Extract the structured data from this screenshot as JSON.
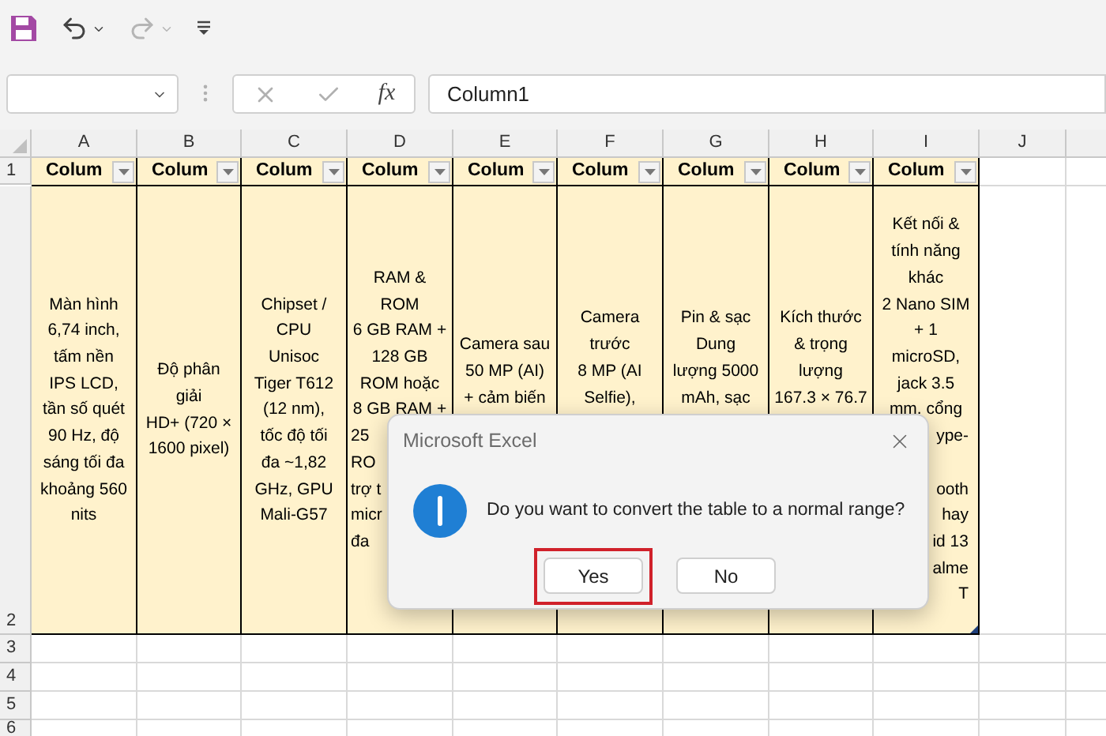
{
  "quick_access": [
    {
      "kind": "save",
      "disabled": false
    },
    {
      "kind": "undo",
      "disabled": false
    },
    {
      "kind": "redo",
      "disabled": true
    },
    {
      "kind": "customize",
      "disabled": false
    }
  ],
  "formula_bar": {
    "function_label": "fx",
    "value": "Column1"
  },
  "columns": [
    "A",
    "B",
    "C",
    "D",
    "E",
    "F",
    "G",
    "H",
    "I",
    "J"
  ],
  "rows": [
    "1",
    "2",
    "3",
    "4",
    "5",
    "6"
  ],
  "table": {
    "headers": [
      {
        "text": "Colum"
      },
      {
        "text": "Colum"
      },
      {
        "text": "Colum"
      },
      {
        "text": "Colum"
      },
      {
        "text": "Colum"
      },
      {
        "text": "Colum"
      },
      {
        "text": "Colum"
      },
      {
        "text": "Colum"
      },
      {
        "text": "Colum"
      }
    ],
    "cells": [
      {
        "kind": "middle",
        "lines": [
          {
            "kind": "whole",
            "text": "Màn hình"
          },
          {
            "kind": "whole",
            "text": "6,74 inch,"
          },
          {
            "kind": "whole",
            "text": "tấm nền"
          },
          {
            "kind": "whole",
            "text": "IPS LCD,"
          },
          {
            "kind": "whole",
            "text": "tần số quét"
          },
          {
            "kind": "whole",
            "text": "90 Hz, độ"
          },
          {
            "kind": "whole",
            "text": "sáng tối đa"
          },
          {
            "kind": "whole",
            "text": "khoảng 560"
          },
          {
            "kind": "whole",
            "text": "nits"
          }
        ]
      },
      {
        "kind": "middle",
        "lines": [
          {
            "kind": "whole",
            "text": "Độ phân"
          },
          {
            "kind": "whole",
            "text": "giải"
          },
          {
            "kind": "whole",
            "text": "HD+ (720 ×"
          },
          {
            "kind": "whole",
            "text": "1600 pixel)"
          }
        ]
      },
      {
        "kind": "middle",
        "lines": [
          {
            "kind": "whole",
            "text": "Chipset /"
          },
          {
            "kind": "whole",
            "text": "CPU"
          },
          {
            "kind": "whole",
            "text": "Unisoc"
          },
          {
            "kind": "whole",
            "text": "Tiger T612"
          },
          {
            "kind": "whole",
            "text": "(12 nm),"
          },
          {
            "kind": "whole",
            "text": "tốc độ tối"
          },
          {
            "kind": "whole",
            "text": "đa ~1,82"
          },
          {
            "kind": "whole",
            "text": "GHz, GPU"
          },
          {
            "kind": "whole",
            "text": "Mali-G57"
          }
        ]
      },
      {
        "kind": "middle",
        "lines": [
          {
            "kind": "whole",
            "text": "RAM &"
          },
          {
            "kind": "whole",
            "text": "ROM"
          },
          {
            "kind": "whole",
            "text": "6 GB RAM +"
          },
          {
            "kind": "whole",
            "text": "128 GB"
          },
          {
            "kind": "whole",
            "text": "ROM hoặc"
          },
          {
            "kind": "whole",
            "text": "8 GB RAM +"
          },
          {
            "kind": "start",
            "text": "25"
          },
          {
            "kind": "start",
            "text": "RO"
          },
          {
            "kind": "start",
            "text": "trợ t"
          },
          {
            "kind": "start",
            "text": "micr"
          },
          {
            "kind": "start",
            "text": "đa"
          }
        ]
      },
      {
        "kind": "covered",
        "lines": [
          {
            "kind": "whole",
            "text": "Camera sau"
          },
          {
            "kind": "whole",
            "text": "50 MP (AI)"
          },
          {
            "kind": "whole",
            "text": "+ cảm biến"
          }
        ]
      },
      {
        "kind": "covered",
        "lines": [
          {
            "kind": "whole",
            "text": "Camera"
          },
          {
            "kind": "whole",
            "text": "trước"
          },
          {
            "kind": "whole",
            "text": "8 MP (AI"
          },
          {
            "kind": "whole",
            "text": "Selfie),"
          }
        ]
      },
      {
        "kind": "covered",
        "lines": [
          {
            "kind": "whole",
            "text": "Pin & sạc"
          },
          {
            "kind": "whole",
            "text": "Dung"
          },
          {
            "kind": "whole",
            "text": "lượng 5000"
          },
          {
            "kind": "whole",
            "text": "mAh, sạc"
          }
        ]
      },
      {
        "kind": "covered",
        "lines": [
          {
            "kind": "whole",
            "text": "Kích thước"
          },
          {
            "kind": "whole",
            "text": "& trọng"
          },
          {
            "kind": "whole",
            "text": "lượng"
          },
          {
            "kind": "whole",
            "text": "167.3 × 76.7"
          }
        ]
      },
      {
        "kind": "middle",
        "lines": [
          {
            "kind": "whole",
            "text": "Kết nối &"
          },
          {
            "kind": "whole",
            "text": "tính năng"
          },
          {
            "kind": "whole",
            "text": "khác"
          },
          {
            "kind": "whole",
            "text": "2 Nano SIM"
          },
          {
            "kind": "whole",
            "text": "+ 1"
          },
          {
            "kind": "whole",
            "text": "microSD,"
          },
          {
            "kind": "whole",
            "text": "jack 3.5"
          },
          {
            "kind": "whole",
            "text": "mm. cổng"
          },
          {
            "kind": "end",
            "text": "ype-"
          },
          {
            "kind": "end",
            "text": "ooth",
            "gap_before": true
          },
          {
            "kind": "end",
            "text": "hay"
          },
          {
            "kind": "end",
            "text": "id 13"
          },
          {
            "kind": "end",
            "text": "alme"
          },
          {
            "kind": "end",
            "text": "T"
          }
        ]
      }
    ]
  },
  "dialog": {
    "title": "Microsoft Excel",
    "message": "Do you want to convert the table to a normal range?",
    "buttons": [
      {
        "label": "Yes",
        "highlighted": true
      },
      {
        "label": "No",
        "highlighted": false
      }
    ]
  }
}
